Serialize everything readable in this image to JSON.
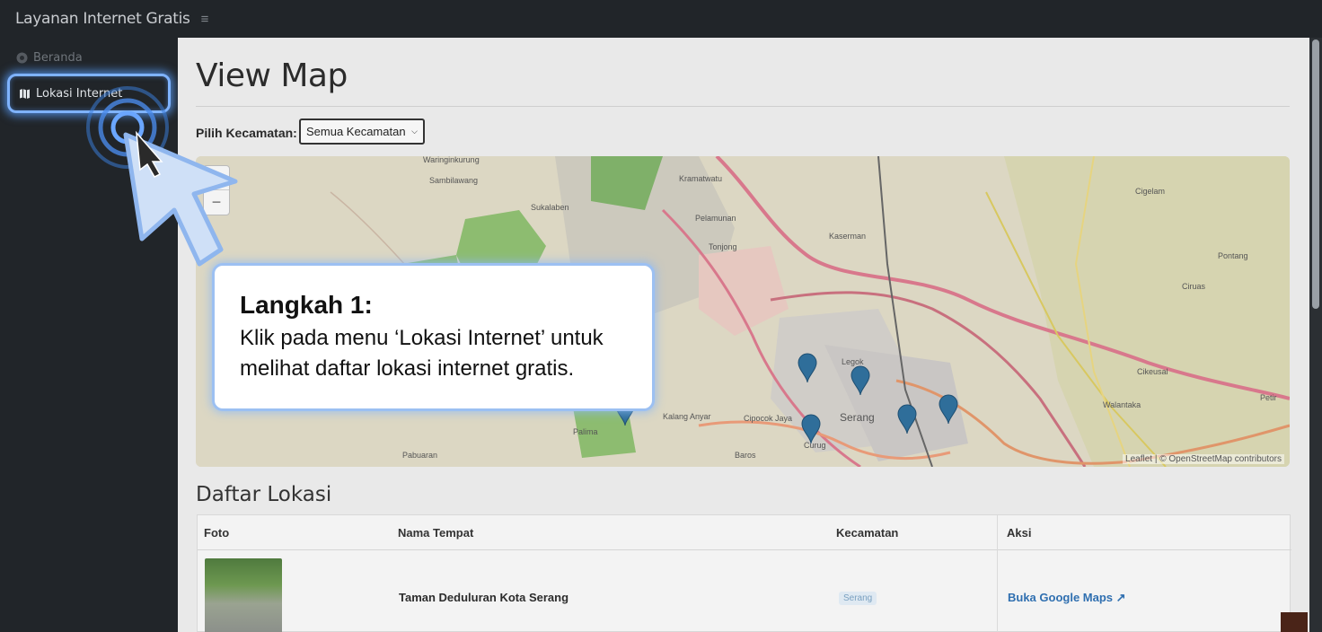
{
  "app": {
    "title": "Layanan Internet Gratis"
  },
  "sidebar": {
    "items": [
      {
        "label": "Beranda",
        "icon": "home-icon"
      },
      {
        "label": "Lokasi Internet",
        "icon": "map-icon",
        "highlighted": true
      }
    ]
  },
  "main": {
    "page_title": "View Map",
    "filter": {
      "label": "Pilih Kecamatan:",
      "selected": "Semua Kecamatan"
    },
    "map": {
      "zoom_in": "+",
      "zoom_out": "−",
      "attribution": "Leaflet | © OpenStreetMap contributors",
      "place_labels": [
        "Waringinkurung",
        "Sambilawang",
        "Sukalaben",
        "Kramatwatu",
        "Pelamunan",
        "Tonjong",
        "Kaserman",
        "Cigelam",
        "Pontang",
        "Ciruas",
        "Serang",
        "Legok",
        "Curug",
        "Kalang Anyar",
        "Cipocok Jaya",
        "Walantaka",
        "Cikeusal",
        "Petir",
        "Baros",
        "Pabuaran",
        "Palima"
      ]
    },
    "list": {
      "title": "Daftar Lokasi",
      "columns": [
        "Foto",
        "Nama Tempat",
        "Kecamatan",
        "Aksi"
      ],
      "rows": [
        {
          "name": "Taman Deduluran Kota Serang",
          "kecamatan": "Serang",
          "action": "Buka Google Maps ↗"
        }
      ]
    }
  },
  "callout": {
    "title": "Langkah 1:",
    "body": "Klik pada menu ‘Lokasi Internet’ untuk melihat daftar lokasi internet gratis."
  },
  "colors": {
    "highlight": "#7fb3ff",
    "marker": "#2f6e9a",
    "link": "#2f6fb0"
  }
}
